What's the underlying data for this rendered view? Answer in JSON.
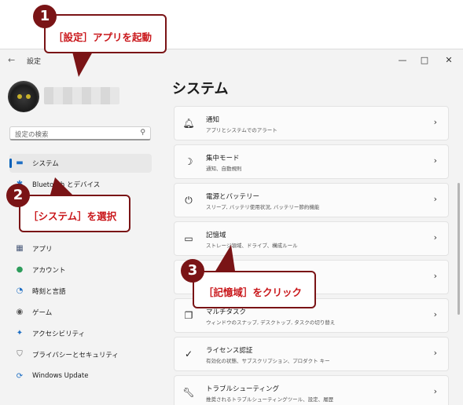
{
  "window": {
    "back_glyph": "←",
    "title": "設定",
    "minimize_glyph": "—",
    "maximize_glyph": "□",
    "close_glyph": "✕"
  },
  "sidebar": {
    "search_placeholder": "設定の検索",
    "search_icon_glyph": "⚲",
    "items": [
      {
        "label": "システム",
        "icon": "monitor-icon",
        "glyph": "▬",
        "color": "#1f6fc4",
        "active": true
      },
      {
        "label": "Bluetooth とデバイス",
        "icon": "bluetooth-icon",
        "glyph": "✱",
        "color": "#1f6fc4"
      },
      {
        "label": "アプリ",
        "icon": "apps-icon",
        "glyph": "▦",
        "color": "#4a5a7a"
      },
      {
        "label": "アカウント",
        "icon": "person-icon",
        "glyph": "●",
        "color": "#2e9d5c"
      },
      {
        "label": "時刻と言語",
        "icon": "clock-globe-icon",
        "glyph": "◔",
        "color": "#1f6fc4"
      },
      {
        "label": "ゲーム",
        "icon": "gamepad-icon",
        "glyph": "◉",
        "color": "#555555"
      },
      {
        "label": "アクセシビリティ",
        "icon": "accessibility-icon",
        "glyph": "✦",
        "color": "#1f6fc4"
      },
      {
        "label": "プライバシーとセキュリティ",
        "icon": "shield-icon",
        "glyph": "⛉",
        "color": "#666666"
      },
      {
        "label": "Windows Update",
        "icon": "update-icon",
        "glyph": "⟳",
        "color": "#1f6fc4"
      }
    ]
  },
  "main": {
    "title": "システム",
    "cards": [
      {
        "title": "通知",
        "subtitle": "アプリとシステムでのアラート",
        "icon": "bell-icon",
        "glyph": "🔔︎"
      },
      {
        "title": "集中モード",
        "subtitle": "通知、自動規則",
        "icon": "moon-icon",
        "glyph": "☽"
      },
      {
        "title": "電源とバッテリー",
        "subtitle": "スリープ, バッテリ使用状況, バッテリー節約機能",
        "icon": "power-icon",
        "glyph": "⏻"
      },
      {
        "title": "記憶域",
        "subtitle": "ストレージ領域、ドライブ、構成ルール",
        "icon": "storage-icon",
        "glyph": "▭"
      },
      {
        "title": "",
        "subtitle": "",
        "icon": "nearby-sharing-icon",
        "glyph": ""
      },
      {
        "title": "マルチタスク",
        "subtitle": "ウィンドウのスナップ, デスクトップ, タスクの切り替え",
        "icon": "multitask-icon",
        "glyph": "❐"
      },
      {
        "title": "ライセンス認証",
        "subtitle": "有効化の状態、サブスクリプション、プロダクト キー",
        "icon": "check-circle-icon",
        "glyph": "✓"
      },
      {
        "title": "トラブルシューティング",
        "subtitle": "推奨されるトラブルシューティングツール、設定、履歴",
        "icon": "wrench-icon",
        "glyph": "🔧︎"
      }
    ],
    "chevron_glyph": "›"
  },
  "annotations": [
    {
      "number": "1",
      "text": "［設定］アプリを起動"
    },
    {
      "number": "2",
      "text": "［システム］を選択"
    },
    {
      "number": "3",
      "text": "［記憶域］をクリック"
    }
  ],
  "colors": {
    "accent": "#005fb8",
    "callout_border": "#7a1416",
    "callout_text": "#c9161a"
  }
}
